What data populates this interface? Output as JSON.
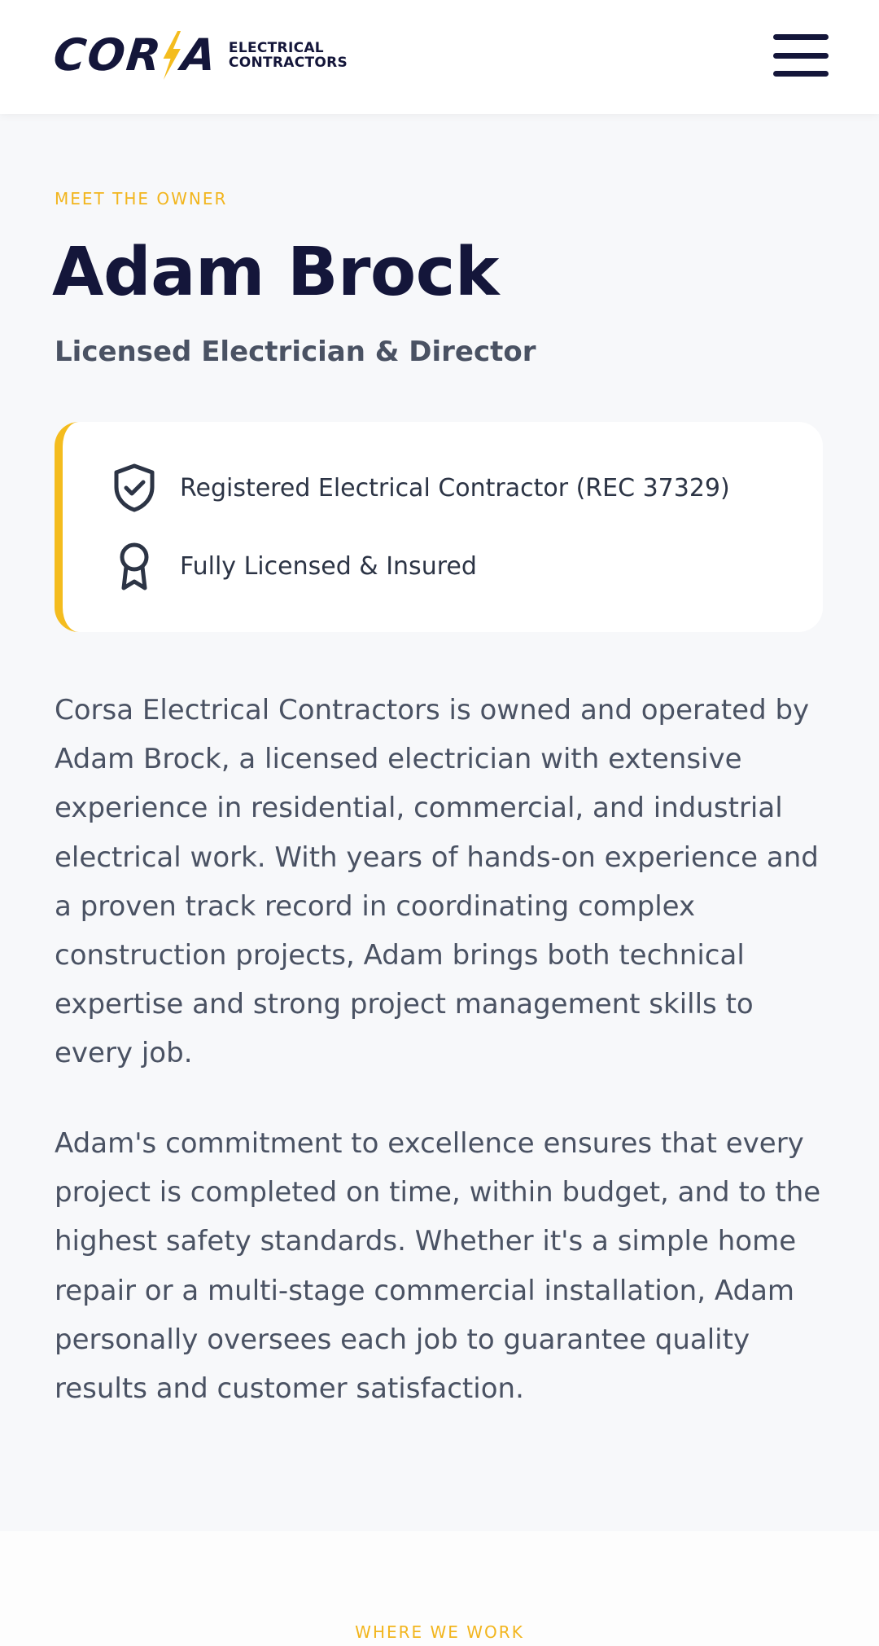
{
  "header": {
    "logo_word": "COR A",
    "logo_sub_line1": "ELECTRICAL",
    "logo_sub_line2": "CONTRACTORS",
    "menu_icon": "hamburger-menu-icon"
  },
  "about": {
    "eyebrow": "MEET THE OWNER",
    "name": "Adam Brock",
    "role": "Licensed Electrician & Director",
    "credentials": [
      {
        "icon": "shield-check-icon",
        "label": "Registered Electrical Contractor (REC 37329)"
      },
      {
        "icon": "award-ribbon-icon",
        "label": "Fully Licensed & Insured"
      }
    ],
    "paragraphs": [
      "Corsa Electrical Contractors is owned and operated by Adam Brock, a licensed electrician with extensive experience in residential, commercial, and industrial electrical work. With years of hands-on experience and a proven track record in coordinating complex construction projects, Adam brings both technical expertise and strong project management skills to every job.",
      "Adam's commitment to excellence ensures that every project is completed on time, within budget, and to the highest safety standards. Whether it's a simple home repair or a multi-stage commercial installation, Adam personally oversees each job to guarantee quality results and customer satisfaction."
    ]
  },
  "next_section": {
    "eyebrow": "WHERE WE WORK"
  },
  "colors": {
    "navy": "#14163a",
    "accent_yellow": "#f4bc1e",
    "body_text": "#4a5263",
    "background": "#f7f8fa"
  }
}
